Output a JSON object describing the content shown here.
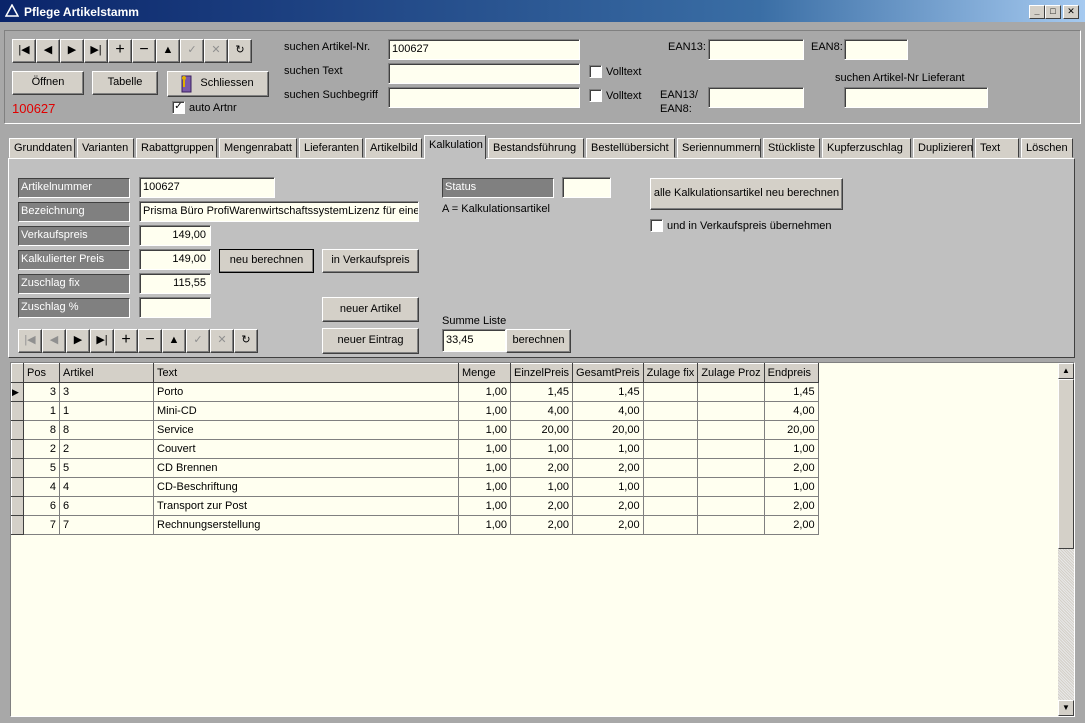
{
  "window": {
    "title": "Pflege Artikelstamm"
  },
  "toolbar": {
    "nav_buttons": [
      "|◀",
      "◀",
      "▶",
      "▶|",
      "+",
      "−",
      "▲",
      "✓",
      "✕",
      "↻"
    ],
    "open_label": "Öffnen",
    "table_label": "Tabelle",
    "close_label": "Schliessen",
    "current_artnr": "100627",
    "auto_artnr_label": "auto Artnr",
    "auto_artnr_checked": true
  },
  "search": {
    "artikel_nr_label": "suchen Artikel-Nr.",
    "artikel_nr_value": "100627",
    "text_label": "suchen Text",
    "text_value": "",
    "suchbegriff_label": "suchen Suchbegriff",
    "suchbegriff_value": "",
    "volltext_label_1": "Volltext",
    "volltext_label_2": "Volltext",
    "ean13_label": "EAN13:",
    "ean13_value": "",
    "ean8_label": "EAN8:",
    "ean8_value": "",
    "ean13_ean8_label_1": "EAN13/",
    "ean13_ean8_label_2": "EAN8:",
    "ean13_ean8_value": "",
    "lieferant_label": "suchen Artikel-Nr Lieferant",
    "lieferant_value": ""
  },
  "tabs": [
    "Grunddaten",
    "Varianten",
    "Rabattgruppen",
    "Mengenrabatt",
    "Lieferanten",
    "Artikelbild",
    "Kalkulation",
    "Bestandsführung",
    "Bestellübersicht",
    "Seriennummern",
    "Stückliste",
    "Kupferzuschlag",
    "Duplizieren",
    "Text",
    "Löschen"
  ],
  "active_tab": "Kalkulation",
  "kalkulation": {
    "artikelnummer_label": "Artikelnummer",
    "artikelnummer_value": "100627",
    "bezeichnung_label": "Bezeichnung",
    "bezeichnung_value": "Prisma Büro ProfiWarenwirtschaftssystemLizenz für eine",
    "verkaufspreis_label": "Verkaufspreis",
    "verkaufspreis_value": "149,00",
    "kalk_preis_label": "Kalkulierter Preis",
    "kalk_preis_value": "149,00",
    "zuschlag_fix_label": "Zuschlag fix",
    "zuschlag_fix_value": "115,55",
    "zuschlag_proz_label": "Zuschlag %",
    "zuschlag_proz_value": "",
    "neu_berechnen_label": "neu berechnen",
    "in_verkaufspreis_label": "in Verkaufspreis",
    "neuer_artikel_label": "neuer Artikel",
    "neuer_eintrag_label": "neuer Eintrag",
    "status_label": "Status",
    "status_value": "",
    "status_hint": "A = Kalkulationsartikel",
    "alle_neu_label": "alle Kalkulationsartikel neu berechnen",
    "uebernehmen_label": "und in Verkaufspreis übernehmen",
    "uebernehmen_checked": false,
    "summe_label": "Summe Liste",
    "summe_value": "33,45",
    "berechnen_label": "berechnen"
  },
  "grid": {
    "columns": [
      "Pos",
      "Artikel",
      "Text",
      "Menge",
      "EinzelPreis",
      "GesamtPreis",
      "Zulage fix",
      "Zulage Proz",
      "Endpreis"
    ],
    "rows": [
      [
        "3",
        "3",
        "Porto",
        "1,00",
        "1,45",
        "1,45",
        "",
        "",
        "1,45"
      ],
      [
        "1",
        "1",
        "Mini-CD",
        "1,00",
        "4,00",
        "4,00",
        "",
        "",
        "4,00"
      ],
      [
        "8",
        "8",
        "Service",
        "1,00",
        "20,00",
        "20,00",
        "",
        "",
        "20,00"
      ],
      [
        "2",
        "2",
        "Couvert",
        "1,00",
        "1,00",
        "1,00",
        "",
        "",
        "1,00"
      ],
      [
        "5",
        "5",
        "CD Brennen",
        "1,00",
        "2,00",
        "2,00",
        "",
        "",
        "2,00"
      ],
      [
        "4",
        "4",
        "CD-Beschriftung",
        "1,00",
        "1,00",
        "1,00",
        "",
        "",
        "1,00"
      ],
      [
        "6",
        "6",
        "Transport zur Post",
        "1,00",
        "2,00",
        "2,00",
        "",
        "",
        "2,00"
      ],
      [
        "7",
        "7",
        "Rechnungserstellung",
        "1,00",
        "2,00",
        "2,00",
        "",
        "",
        "2,00"
      ]
    ]
  },
  "colors": {
    "titlebar": "#0a246a",
    "artnr_red": "#e00000",
    "face": "#d4d0c8",
    "input_bg": "#fffff0"
  }
}
